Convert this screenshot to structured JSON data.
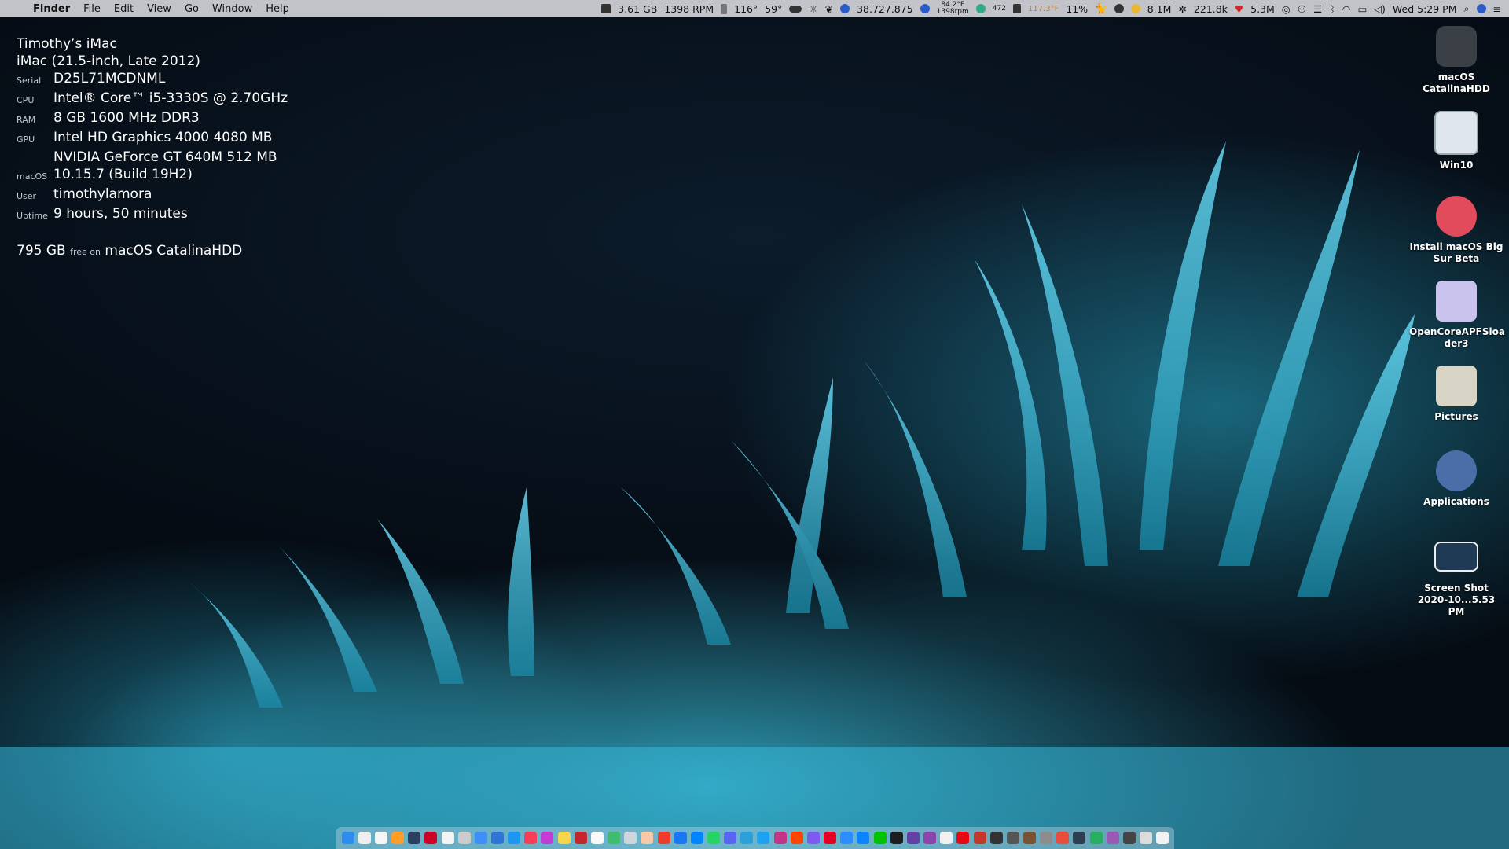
{
  "menubar": {
    "apple_glyph": "",
    "app_name": "Finder",
    "menus": [
      "File",
      "Edit",
      "View",
      "Go",
      "Window",
      "Help"
    ],
    "status": {
      "memory": "3.61 GB",
      "fan": "1398 RPM",
      "cpu_temp": "116°",
      "weather_temp": "59°",
      "stocks": "38.727.875",
      "temp_small": "84.2°F",
      "rpm_small": "1398rpm",
      "count": "472",
      "temp_orange": "117.3°F",
      "percent": "11%",
      "stat1": "8.1M",
      "stat2": "221.8k",
      "stat3": "5.3M",
      "clock": "Wed 5:29 PM"
    }
  },
  "sysinfo": {
    "name": "Timothy’s iMac",
    "model": "iMac (21.5-inch, Late 2012)",
    "rows": [
      {
        "key": "Serial",
        "value": "D25L71MCDNML"
      },
      {
        "key": "CPU",
        "value": "Intel® Core™ i5-3330S @ 2.70GHz"
      },
      {
        "key": "RAM",
        "value": "8 GB 1600 MHz DDR3"
      },
      {
        "key": "GPU",
        "value": "Intel HD Graphics 4000 4080 MB"
      },
      {
        "key": "",
        "value": "NVIDIA GeForce GT 640M 512 MB"
      },
      {
        "key": "macOS",
        "value": "10.15.7 (Build 19H2)"
      },
      {
        "key": "User",
        "value": "timothylamora"
      },
      {
        "key": "Uptime",
        "value": "9 hours, 50 minutes"
      }
    ],
    "free_size": "795 GB",
    "free_label": "free on",
    "free_disk": "macOS CatalinaHDD"
  },
  "desktop_icons": [
    {
      "label": "macOS\nCatalinaHDD",
      "icon": "hard-drive-icon",
      "color": "#3b3f46"
    },
    {
      "label": "Win10",
      "icon": "computer-icon",
      "color": "#dfe6ee"
    },
    {
      "label": "Install macOS Big\nSur Beta",
      "icon": "installer-icon",
      "color": "#e24b5c"
    },
    {
      "label": "OpenCoreAPFSloa\nder3",
      "icon": "disk-image-icon",
      "color": "#c9c3ee"
    },
    {
      "label": "Pictures",
      "icon": "classic-mac-icon",
      "color": "#d9d5c6"
    },
    {
      "label": "Applications",
      "icon": "folder-icon",
      "color": "#4a6fa8"
    },
    {
      "label": "Screen Shot\n2020-10...5.53 PM",
      "icon": "screenshot-icon",
      "color": "#1e3a55"
    }
  ],
  "dock": {
    "colors": [
      "#2d8cf0",
      "#eee",
      "#f5f5f5",
      "#ff9d2a",
      "#2a3f5f",
      "#c02",
      "#f4f4f4",
      "#ccc",
      "#3e8ef7",
      "#2e73d6",
      "#1d95f2",
      "#fa3d56",
      "#c23cd6",
      "#f7d64b",
      "#c1272d",
      "#f8f8f8",
      "#3fbc6c",
      "#cfd5db",
      "#f6c9a8",
      "#ee3b2b",
      "#1977f3",
      "#0084ff",
      "#25d366",
      "#5865f2",
      "#2aa1da",
      "#1da1f2",
      "#c13584",
      "#ff4500",
      "#7e5bef",
      "#e60023",
      "#2d8cff",
      "#0a84ff",
      "#00c300",
      "#1d1d1f",
      "#6441a5",
      "#8e44ad",
      "#f1f1f1",
      "#e50914",
      "#c0392b",
      "#333",
      "#555",
      "#7a5230",
      "#8c8c8c",
      "#e74c3c",
      "#2c3e50",
      "#27ae60",
      "#9b59b6",
      "#444",
      "#dcdcdc",
      "#f2f2f2"
    ]
  }
}
